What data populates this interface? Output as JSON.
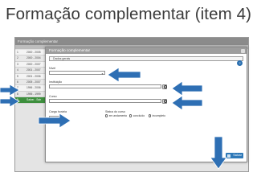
{
  "slide": {
    "title": "Formação complementar (item 4)"
  },
  "app": {
    "header_title": "Formação complementar",
    "list_rows": [
      {
        "num": "1",
        "text": "2000 - 2005"
      },
      {
        "num": "2",
        "text": "2000 - 2004"
      },
      {
        "num": "3",
        "text": "2000 - 2007"
      },
      {
        "num": "4",
        "text": "2001 - 2007"
      },
      {
        "num": "5",
        "text": "2001 - 2006"
      },
      {
        "num": "6",
        "text": "2005 - 2007"
      },
      {
        "num": "7",
        "text": "1996 - 2006"
      },
      {
        "num": "8",
        "text": "1995 - 1999"
      },
      {
        "num": "9",
        "text": "Salvar - Sair"
      }
    ]
  },
  "modal": {
    "title": "Formação complementar",
    "tab_label": "Dados gerais",
    "fields": {
      "nivel_label": "Nível",
      "instituicao_label": "Instituição",
      "curso_label": "Curso",
      "carga_label": "Carga horária",
      "status_label": "Status do curso"
    },
    "status_options": [
      "em andamento",
      "concluído",
      "incompleto"
    ],
    "save_label": "Salvar"
  },
  "colors": {
    "arrow": "#2e6fb4",
    "save": "#2f79b8",
    "selected_row": "#3d8f3d"
  }
}
